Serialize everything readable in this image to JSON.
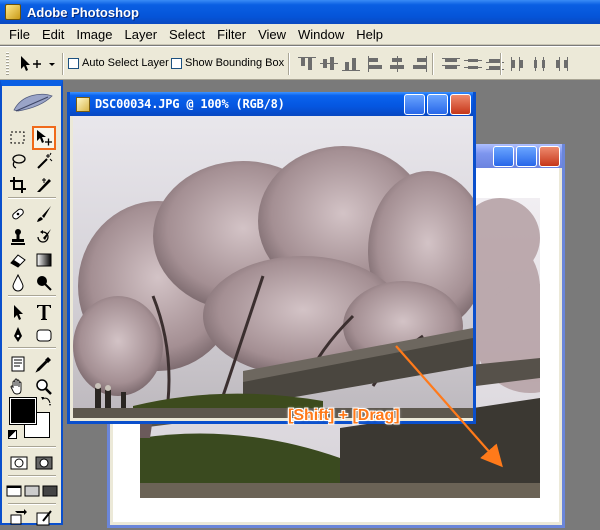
{
  "app": {
    "title": "Adobe Photoshop"
  },
  "menu": [
    "File",
    "Edit",
    "Image",
    "Layer",
    "Select",
    "Filter",
    "View",
    "Window",
    "Help"
  ],
  "options": {
    "auto_select_label": "Auto Select Layer",
    "show_bounding_label": "Show Bounding Box"
  },
  "front_document": {
    "title": "DSC00034.JPG @ 100% (RGB/8)"
  },
  "annotation": {
    "label": "[Shift] + [Drag]",
    "color": "#ff7a1a"
  },
  "colors": {
    "foreground": "#000000",
    "background": "#ffffff",
    "title_bar": "#0a5fe3",
    "highlight": "#f06a1a"
  },
  "tools": [
    "marquee-icon",
    "move-icon",
    "lasso-icon",
    "magic-wand-icon",
    "crop-icon",
    "slice-icon",
    "healing-brush-icon",
    "brush-icon",
    "clone-stamp-icon",
    "history-brush-icon",
    "eraser-icon",
    "gradient-icon",
    "blur-icon",
    "dodge-icon",
    "path-selection-icon",
    "type-icon",
    "pen-icon",
    "shape-icon",
    "notes-icon",
    "eyedropper-icon",
    "hand-icon",
    "zoom-icon"
  ]
}
